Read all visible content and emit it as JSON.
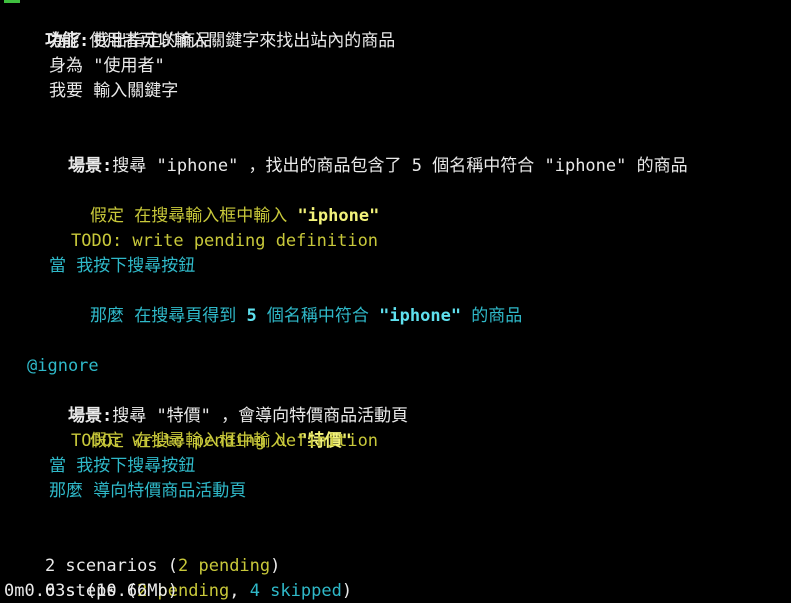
{
  "colors": {
    "background": "#000000",
    "text": "#e8e8e8",
    "pending": "#c8c83a",
    "skipped": "#2fb9c9",
    "highlight_yellow": "#f2f27a",
    "highlight_cyan": "#5fe0ee",
    "cursor": "#3fbf3f"
  },
  "feature": {
    "keyword": "功能:",
    "text": "使用者可以輸入關鍵字來找出站內的商品",
    "in_order_to": "為了 找出指定的商品",
    "as_a": "身為 \"使用者\"",
    "i_want": "我要 輸入關鍵字"
  },
  "scenario1": {
    "keyword": "場景:",
    "text": "搜尋 \"iphone\" ，找出的商品包含了 5 個名稱中符合 \"iphone\" 的商品",
    "given_prefix": "假定 在搜尋輸入框中輸入 ",
    "given_arg": "\"iphone\"",
    "todo": "TODO: write pending definition",
    "when": "當 我按下搜尋按鈕",
    "then_prefix": "那麼 在搜尋頁得到 ",
    "then_arg1": "5",
    "then_mid": " 個名稱中符合 ",
    "then_arg2": "\"iphone\"",
    "then_suffix": " 的商品"
  },
  "scenario2": {
    "tag": "@ignore",
    "keyword": "場景:",
    "text": "搜尋 \"特價\" ，會導向特價商品活動頁",
    "given_prefix": "假定 在搜尋輸入框中輸入 ",
    "given_arg": "\"特價\"",
    "todo": "TODO: write pending definition",
    "when": "當 我按下搜尋按鈕",
    "then": "那麼 導向特價商品活動頁"
  },
  "summary": {
    "scenarios_prefix": "2 scenarios (",
    "scenarios_pending": "2 pending",
    "scenarios_suffix": ")",
    "steps_prefix": "6 steps (",
    "steps_pending": "2 pending",
    "steps_sep": ", ",
    "steps_skipped": "4 skipped",
    "steps_suffix": ")",
    "timing": "0m0.03s (10.66Mb)"
  }
}
